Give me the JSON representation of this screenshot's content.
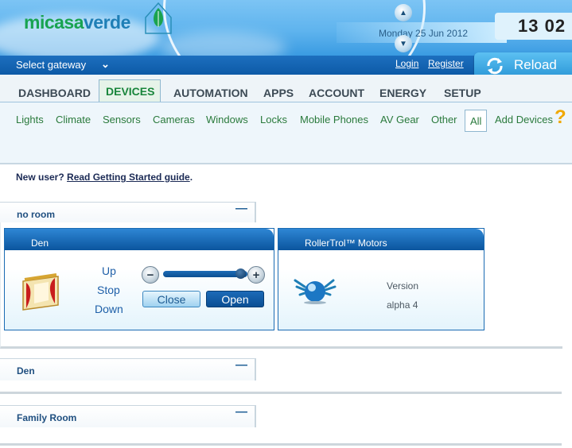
{
  "header": {
    "logo_part1": "micasa",
    "logo_part2": "verde",
    "date": "Monday 25 Jun 2012",
    "time": "13 02"
  },
  "topbar": {
    "gateway_label": "Select gateway",
    "login": "Login",
    "register": "Register",
    "reload": "Reload"
  },
  "nav": {
    "tabs": [
      "DASHBOARD",
      "DEVICES",
      "AUTOMATION",
      "APPS",
      "ACCOUNT",
      "ENERGY",
      "SETUP"
    ],
    "active": "DEVICES"
  },
  "subnav": {
    "items": [
      "Lights",
      "Climate",
      "Sensors",
      "Cameras",
      "Windows",
      "Locks",
      "Mobile Phones",
      "AV Gear",
      "Other",
      "All",
      "Add Devices"
    ],
    "active": "All"
  },
  "notice": {
    "prefix": "New user?",
    "link": "Read Getting Started guide",
    "suffix": "."
  },
  "rooms": [
    {
      "name": "no room",
      "devices": [
        {
          "name": "Den",
          "icon": "curtain-icon",
          "controls": [
            "Up",
            "Stop",
            "Down"
          ],
          "slider_value_percent": 95,
          "buttons": [
            "Close",
            "Open"
          ],
          "active_button": "Open"
        },
        {
          "name": "RollerTrol™ Motors",
          "icon": "zwave-device-icon",
          "info_label": "Version",
          "info_value": "alpha 4"
        }
      ]
    },
    {
      "name": "Den",
      "devices": []
    },
    {
      "name": "Family Room",
      "devices": []
    }
  ],
  "colors": {
    "brand_green": "#18a351",
    "brand_blue": "#1f7fb6",
    "bar_blue": "#0d5aa7",
    "subnav_green": "#2a7a3c",
    "help_orange": "#f0a800"
  }
}
